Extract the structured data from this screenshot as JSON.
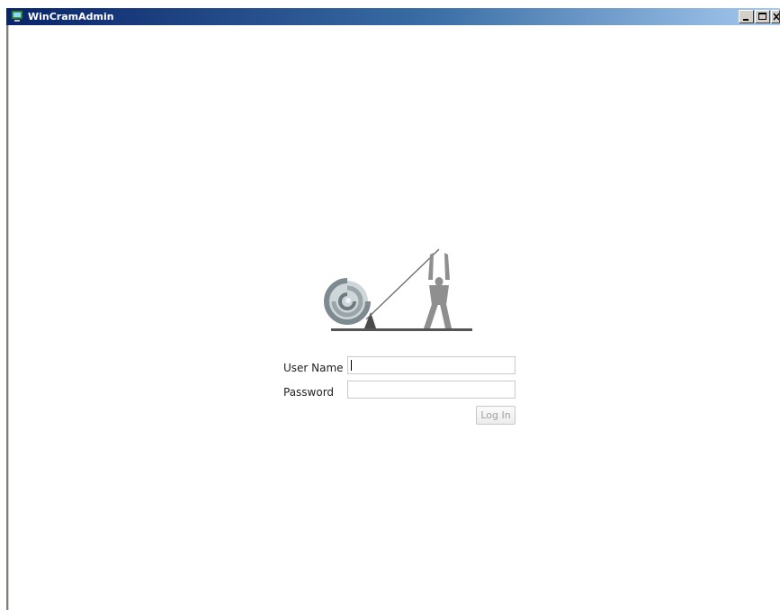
{
  "window": {
    "title": "WinCramAdmin",
    "controls": {
      "minimize_icon": "minimize-icon",
      "maximize_icon": "maximize-icon",
      "close_icon": "close-icon"
    }
  },
  "login": {
    "username_label": "User Name",
    "username_value": "",
    "password_label": "Password",
    "password_value": "",
    "login_button_label": "Log In",
    "login_button_enabled": false
  },
  "logo": {
    "icon": "lever-figure-logo"
  },
  "colors": {
    "titlebar_start": "#0a246a",
    "titlebar_end": "#a6caf0",
    "logo_gray": "#8a8a8a",
    "logo_dark": "#4a4a4a"
  }
}
